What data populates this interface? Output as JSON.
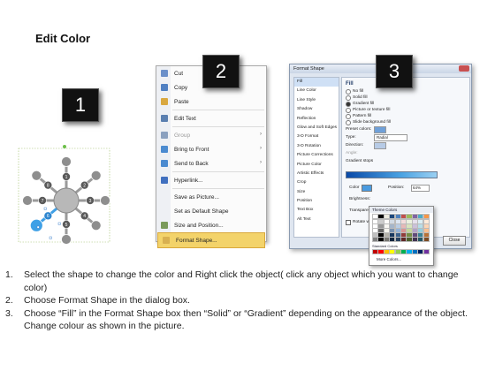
{
  "title": "Edit Color",
  "steps": {
    "one": "1",
    "two": "2",
    "three": "3"
  },
  "diagram": {
    "nodes": [
      "1",
      "2",
      "3",
      "4",
      "5",
      "6",
      "7",
      "8"
    ],
    "colors": {
      "gray": "#8e8e8e",
      "dark": "#5a5a5a",
      "blue": "#3fa0e6",
      "center": "#b8b8b8"
    }
  },
  "context_menu": {
    "items": [
      {
        "label": "Cut",
        "icon": "scissors-icon",
        "disabled": false,
        "submenu": false
      },
      {
        "label": "Copy",
        "icon": "copy-icon",
        "disabled": false,
        "submenu": false
      },
      {
        "label": "Paste",
        "icon": "paste-icon",
        "disabled": false,
        "submenu": false
      },
      {
        "label": "Edit Text",
        "icon": "edit-text-icon",
        "disabled": false,
        "submenu": false
      },
      {
        "label": "Group",
        "icon": "group-icon",
        "disabled": true,
        "submenu": true
      },
      {
        "label": "Bring to Front",
        "icon": "bring-front-icon",
        "disabled": false,
        "submenu": true
      },
      {
        "label": "Send to Back",
        "icon": "send-back-icon",
        "disabled": false,
        "submenu": true
      },
      {
        "label": "Hyperlink...",
        "icon": "hyperlink-icon",
        "disabled": false,
        "submenu": false
      },
      {
        "label": "Save as Picture...",
        "icon": "",
        "disabled": false,
        "submenu": false
      },
      {
        "label": "Set as Default Shape",
        "icon": "",
        "disabled": false,
        "submenu": false
      },
      {
        "label": "Size and Position...",
        "icon": "size-position-icon",
        "disabled": false,
        "submenu": false
      },
      {
        "label": "Format Shape...",
        "icon": "format-shape-icon",
        "disabled": false,
        "submenu": false,
        "selected": true
      }
    ]
  },
  "format_dialog": {
    "title": "Format Shape",
    "categories": [
      "Fill",
      "Line Color",
      "Line Style",
      "Shadow",
      "Reflection",
      "Glow and Soft Edges",
      "3-D Format",
      "3-D Rotation",
      "Picture Corrections",
      "Picture Color",
      "Artistic Effects",
      "Crop",
      "Size",
      "Position",
      "Text Box",
      "Alt Text"
    ],
    "panel_heading": "Fill",
    "fill_options": [
      {
        "label": "No fill",
        "checked": false
      },
      {
        "label": "Solid fill",
        "checked": false
      },
      {
        "label": "Gradient fill",
        "checked": true
      },
      {
        "label": "Picture or texture fill",
        "checked": false
      },
      {
        "label": "Pattern fill",
        "checked": false
      },
      {
        "label": "Slide background fill",
        "checked": false
      }
    ],
    "preset_label": "Preset colors:",
    "type_label": "Type:",
    "type_value": "Radial",
    "direction_label": "Direction:",
    "angle_label": "Angle:",
    "gradient_stops_label": "Gradient stops",
    "color_label": "Color",
    "position_label": "Position:",
    "position_value": "64%",
    "brightness_label": "Brightness:",
    "transparency_label": "Transparency:",
    "rotate_label": "Rotate with shape",
    "close_label": "Close"
  },
  "color_picker": {
    "theme_label": "Theme Colors",
    "standard_label": "Standard Colors",
    "more_label": "More Colors...",
    "theme_top": [
      "#ffffff",
      "#000000",
      "#eeece1",
      "#1f497d",
      "#4f81bd",
      "#c0504d",
      "#9bbb59",
      "#8064a2",
      "#4bacc6",
      "#f79646"
    ],
    "standard": [
      "#c00000",
      "#ff0000",
      "#ffc000",
      "#ffff00",
      "#92d050",
      "#00b050",
      "#00b0f0",
      "#0070c0",
      "#002060",
      "#7030a0"
    ]
  },
  "instructions": [
    {
      "num": "1.",
      "text": "Select the shape to change the color and Right click the object( click any object which you want to change color)"
    },
    {
      "num": "2.",
      "text": "Choose Format Shape in the dialog box."
    },
    {
      "num": "3.",
      "text": "Choose “Fill” in the Format Shape box then “Solid” or “Gradient” depending on the appearance of the object. Change colour as shown in the picture."
    }
  ]
}
